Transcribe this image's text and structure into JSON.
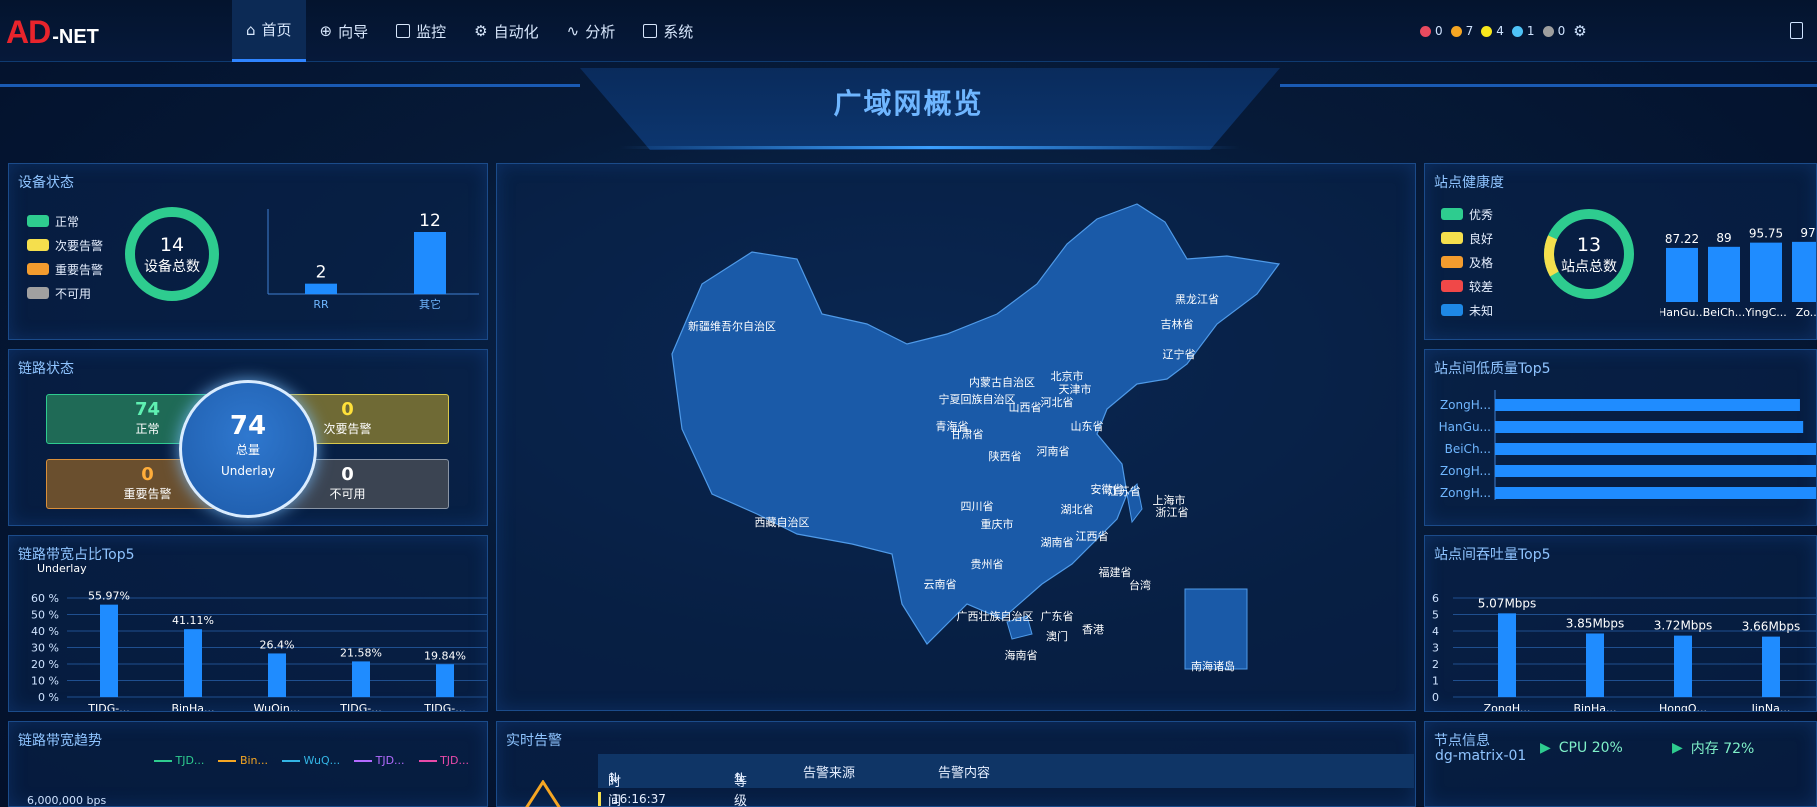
{
  "app": {
    "logo_ad": "AD",
    "logo_net": "-NET"
  },
  "nav": {
    "items": [
      {
        "label": "首页",
        "icon": "home-icon",
        "active": true
      },
      {
        "label": "向导",
        "icon": "compass-icon",
        "active": false
      },
      {
        "label": "监控",
        "icon": "monitor-icon",
        "active": false
      },
      {
        "label": "自动化",
        "icon": "automation-icon",
        "active": false
      },
      {
        "label": "分析",
        "icon": "chart-icon",
        "active": false
      },
      {
        "label": "系统",
        "icon": "system-icon",
        "active": false
      }
    ]
  },
  "alarm_counts": [
    {
      "value": "0",
      "color": "#e84a5f"
    },
    {
      "value": "7",
      "color": "#f5a623"
    },
    {
      "value": "4",
      "color": "#f8e71c"
    },
    {
      "value": "1",
      "color": "#4fc3f7"
    },
    {
      "value": "0",
      "color": "#9e9e9e"
    }
  ],
  "page_title": "广域网概览",
  "device_status": {
    "title": "设备状态",
    "legend": [
      {
        "label": "正常",
        "color": "#2ecc8f"
      },
      {
        "label": "次要告警",
        "color": "#f5df4d"
      },
      {
        "label": "重要告警",
        "color": "#f39c2e"
      },
      {
        "label": "不可用",
        "color": "#a0a0a0"
      }
    ],
    "total": "14",
    "total_label": "设备总数"
  },
  "link_status": {
    "title": "链路状态",
    "normal": {
      "value": "74",
      "label": "正常"
    },
    "minor": {
      "value": "0",
      "label": "次要告警"
    },
    "major": {
      "value": "0",
      "label": "重要告警"
    },
    "unavailable": {
      "value": "0",
      "label": "不可用"
    },
    "total": {
      "value": "74",
      "label": "总量",
      "sub": "Underlay"
    }
  },
  "bandwidth_top5": {
    "title": "链路带宽占比Top5",
    "series_label": "Underlay"
  },
  "bandwidth_trend": {
    "title": "链路带宽趋势",
    "legend": [
      {
        "label": "TJD...",
        "color": "#2ecc8f"
      },
      {
        "label": "Bin...",
        "color": "#f5a623"
      },
      {
        "label": "WuQ...",
        "color": "#33b5e5"
      },
      {
        "label": "TJD...",
        "color": "#b36bff"
      },
      {
        "label": "TJD...",
        "color": "#e84aa8"
      }
    ],
    "y_first": "6,000,000 bps"
  },
  "map": {
    "islands_label": "南海诸岛",
    "provinces": [
      "新疆维吾尔自治区",
      "西藏自治区",
      "内蒙古自治区",
      "黑龙江省",
      "吉林省",
      "辽宁省",
      "北京市",
      "天津市",
      "河北省",
      "山西省",
      "宁夏回族自治区",
      "青海省",
      "甘肃省",
      "陕西省",
      "山东省",
      "河南省",
      "安徽省",
      "江苏省",
      "上海市",
      "浙江省",
      "湖北省",
      "四川省",
      "重庆市",
      "湖南省",
      "江西省",
      "贵州省",
      "云南省",
      "福建省",
      "台湾",
      "广西壮族自治区",
      "广东省",
      "香港",
      "澳门",
      "海南省"
    ]
  },
  "realtime_alarm": {
    "title": "实时告警",
    "columns": [
      "时间",
      "等级",
      "告警来源",
      "告警内容"
    ],
    "row_time": "16:16:37"
  },
  "site_health": {
    "title": "站点健康度",
    "legend": [
      {
        "label": "优秀",
        "color": "#2ecc8f"
      },
      {
        "label": "良好",
        "color": "#f5df4d"
      },
      {
        "label": "及格",
        "color": "#f39c2e"
      },
      {
        "label": "较差",
        "color": "#f04848"
      },
      {
        "label": "未知",
        "color": "#1e88e5"
      }
    ],
    "total": "13",
    "total_label": "站点总数"
  },
  "site_quality": {
    "title": "站点间低质量Top5"
  },
  "site_throughput": {
    "title": "站点间吞吐量Top5"
  },
  "node_info": {
    "title": "节点信息",
    "node": "dg-matrix-01",
    "cpu": "CPU 20%",
    "memory": "内存 72%"
  },
  "chart_data": [
    {
      "type": "bar",
      "title": "",
      "categories": [
        "RR",
        "其它"
      ],
      "values": [
        2,
        12
      ]
    },
    {
      "type": "bar",
      "title": "链路带宽占比Top5",
      "categories": [
        "TJDG-...",
        "BinHa...",
        "WuQin...",
        "TJDG-...",
        "TJDG-..."
      ],
      "values": [
        55.97,
        41.11,
        26.4,
        21.58,
        19.84
      ],
      "data_labels": [
        "55.97%",
        "41.11%",
        "26.4%",
        "21.58%",
        "19.84%"
      ],
      "yticks": [
        "0 %",
        "10 %",
        "20 %",
        "30 %",
        "40 %",
        "50 %",
        "60 %"
      ],
      "ylim": [
        0,
        60
      ]
    },
    {
      "type": "bar",
      "title": "站点健康度",
      "categories": [
        "HanGu...",
        "BeiCh...",
        "YingC...",
        "Zo..."
      ],
      "values": [
        87.22,
        89,
        95.75,
        97
      ],
      "data_labels": [
        "87.22",
        "89",
        "95.75",
        "97"
      ],
      "ylim": [
        0,
        100
      ]
    },
    {
      "type": "bar",
      "title": "站点间低质量Top5",
      "categories": [
        "ZongH...",
        "HanGu...",
        "BeiCh...",
        "ZongH...",
        "ZongH..."
      ],
      "values": [
        95,
        96,
        100,
        100,
        100
      ]
    },
    {
      "type": "bar",
      "title": "站点间吞吐量Top5",
      "categories": [
        "ZongH...",
        "BinHa...",
        "HongQ...",
        "JinNa..."
      ],
      "values": [
        5.07,
        3.85,
        3.72,
        3.66
      ],
      "data_labels": [
        "5.07Mbps",
        "3.85Mbps",
        "3.72Mbps",
        "3.66Mbps"
      ],
      "yticks": [
        "0",
        "1",
        "2",
        "3",
        "4",
        "5",
        "6"
      ],
      "ylim": [
        0,
        6
      ]
    }
  ]
}
